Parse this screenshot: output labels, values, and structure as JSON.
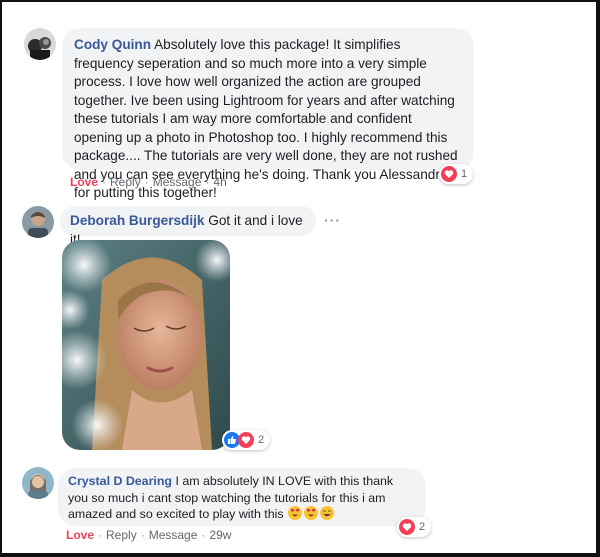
{
  "comments": [
    {
      "author": "Cody Quinn",
      "text": "Absolutely love this package! It simplifies frequency seperation and so much more into a very simple process. I love how well organized the action are grouped together. Ive been using Lightroom for years and after watching these tutorials I am way more comfortable and confident opening up a photo in Photoshop too. I highly recommend this package.... The tutorials are very well done, they are not rushed and you can see everything he's doing. Thank you Alessandro for putting this together!",
      "actions": {
        "love": "Love",
        "reply": "Reply",
        "message": "Message",
        "time": "4h"
      },
      "reaction_count": "1"
    },
    {
      "author": "Deborah Burgersdijk",
      "text": "Got it and i love it!",
      "more": "···",
      "reaction_count": "2"
    },
    {
      "author": "Crystal D Dearing",
      "text": "I am absolutely IN LOVE with this thank you so much i cant stop watching the tutorials for this i am amazed and so excited to play with this",
      "actions": {
        "love": "Love",
        "reply": "Reply",
        "message": "Message",
        "time": "29w"
      },
      "reaction_count": "2"
    }
  ],
  "colors": {
    "author": "#385898",
    "love": "#f33e58",
    "like": "#1877f2",
    "bubble": "#f2f3f5"
  },
  "icons": {
    "heart": "heart-icon",
    "like": "thumbs-up-icon",
    "heart_eyes": "heart-eyes-emoji",
    "grin": "grinning-emoji"
  }
}
